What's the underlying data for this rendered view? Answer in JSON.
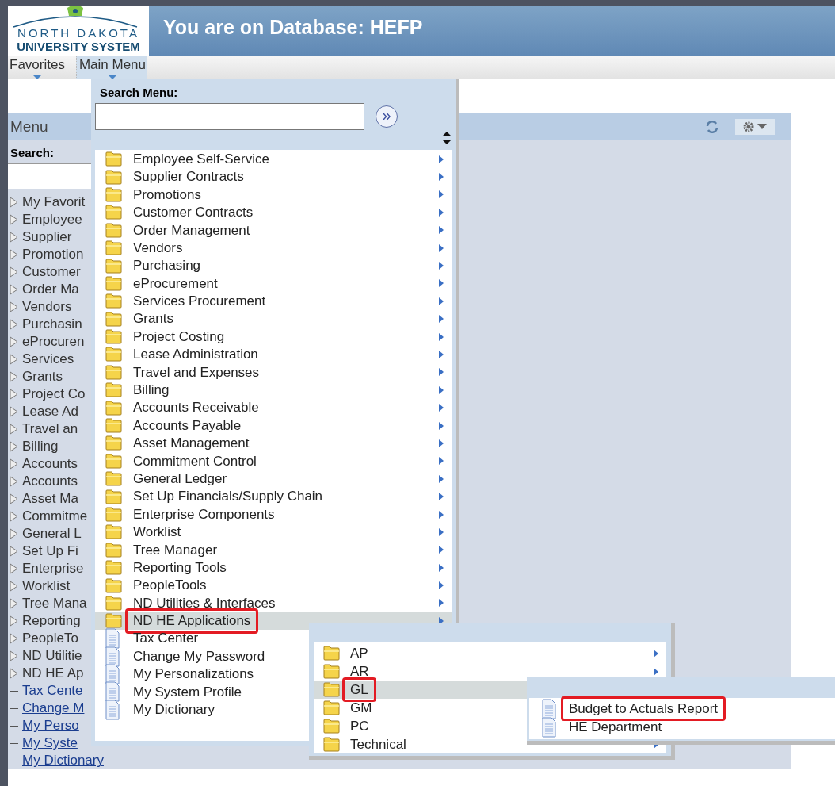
{
  "header": {
    "logo_line1": "NORTH DAKOTA",
    "logo_line2": "UNIVERSITY SYSTEM",
    "title": "You are on Database: HEFP"
  },
  "nav": [
    {
      "label": "Favorites",
      "selected": false
    },
    {
      "label": "Main Menu",
      "selected": true
    }
  ],
  "menu_pagelet": {
    "title": "Menu",
    "search_label": "Search:",
    "items": [
      {
        "label": "My Favorit",
        "kind": "folder"
      },
      {
        "label": "Employee",
        "kind": "folder"
      },
      {
        "label": "Supplier",
        "kind": "folder"
      },
      {
        "label": "Promotion",
        "kind": "folder"
      },
      {
        "label": "Customer",
        "kind": "folder"
      },
      {
        "label": "Order Ma",
        "kind": "folder"
      },
      {
        "label": "Vendors",
        "kind": "folder"
      },
      {
        "label": "Purchasin",
        "kind": "folder"
      },
      {
        "label": "eProcuren",
        "kind": "folder"
      },
      {
        "label": "Services",
        "kind": "folder"
      },
      {
        "label": "Grants",
        "kind": "folder"
      },
      {
        "label": "Project Co",
        "kind": "folder"
      },
      {
        "label": "Lease Ad",
        "kind": "folder"
      },
      {
        "label": "Travel an",
        "kind": "folder"
      },
      {
        "label": "Billing",
        "kind": "folder"
      },
      {
        "label": "Accounts",
        "kind": "folder"
      },
      {
        "label": "Accounts",
        "kind": "folder"
      },
      {
        "label": "Asset Ma",
        "kind": "folder"
      },
      {
        "label": "Commitme",
        "kind": "folder"
      },
      {
        "label": "General L",
        "kind": "folder"
      },
      {
        "label": "Set Up Fi",
        "kind": "folder"
      },
      {
        "label": "Enterprise",
        "kind": "folder"
      },
      {
        "label": "Worklist",
        "kind": "folder"
      },
      {
        "label": "Tree Mana",
        "kind": "folder"
      },
      {
        "label": "Reporting",
        "kind": "folder"
      },
      {
        "label": "PeopleTo",
        "kind": "folder"
      },
      {
        "label": "ND Utilitie",
        "kind": "folder"
      },
      {
        "label": "ND HE Ap",
        "kind": "folder"
      },
      {
        "label": "Tax Cente",
        "kind": "link"
      },
      {
        "label": "Change M",
        "kind": "link"
      },
      {
        "label": "My Perso",
        "kind": "link"
      },
      {
        "label": "My Syste",
        "kind": "link"
      },
      {
        "label": "My Dictionary",
        "kind": "link"
      }
    ]
  },
  "main_menu": {
    "search_label": "Search Menu:",
    "go_symbol": "»",
    "items": [
      {
        "label": "Employee Self-Service",
        "kind": "folder",
        "selected": false,
        "highlighted": false
      },
      {
        "label": "Supplier Contracts",
        "kind": "folder",
        "selected": false,
        "highlighted": false
      },
      {
        "label": "Promotions",
        "kind": "folder",
        "selected": false,
        "highlighted": false
      },
      {
        "label": "Customer Contracts",
        "kind": "folder",
        "selected": false,
        "highlighted": false
      },
      {
        "label": "Order Management",
        "kind": "folder",
        "selected": false,
        "highlighted": false
      },
      {
        "label": "Vendors",
        "kind": "folder",
        "selected": false,
        "highlighted": false
      },
      {
        "label": "Purchasing",
        "kind": "folder",
        "selected": false,
        "highlighted": false
      },
      {
        "label": "eProcurement",
        "kind": "folder",
        "selected": false,
        "highlighted": false
      },
      {
        "label": "Services Procurement",
        "kind": "folder",
        "selected": false,
        "highlighted": false
      },
      {
        "label": "Grants",
        "kind": "folder",
        "selected": false,
        "highlighted": false
      },
      {
        "label": "Project Costing",
        "kind": "folder",
        "selected": false,
        "highlighted": false
      },
      {
        "label": "Lease Administration",
        "kind": "folder",
        "selected": false,
        "highlighted": false
      },
      {
        "label": "Travel and Expenses",
        "kind": "folder",
        "selected": false,
        "highlighted": false
      },
      {
        "label": "Billing",
        "kind": "folder",
        "selected": false,
        "highlighted": false
      },
      {
        "label": "Accounts Receivable",
        "kind": "folder",
        "selected": false,
        "highlighted": false
      },
      {
        "label": "Accounts Payable",
        "kind": "folder",
        "selected": false,
        "highlighted": false
      },
      {
        "label": "Asset Management",
        "kind": "folder",
        "selected": false,
        "highlighted": false
      },
      {
        "label": "Commitment Control",
        "kind": "folder",
        "selected": false,
        "highlighted": false
      },
      {
        "label": "General Ledger",
        "kind": "folder",
        "selected": false,
        "highlighted": false
      },
      {
        "label": "Set Up Financials/Supply Chain",
        "kind": "folder",
        "selected": false,
        "highlighted": false
      },
      {
        "label": "Enterprise Components",
        "kind": "folder",
        "selected": false,
        "highlighted": false
      },
      {
        "label": "Worklist",
        "kind": "folder",
        "selected": false,
        "highlighted": false
      },
      {
        "label": "Tree Manager",
        "kind": "folder",
        "selected": false,
        "highlighted": false
      },
      {
        "label": "Reporting Tools",
        "kind": "folder",
        "selected": false,
        "highlighted": false
      },
      {
        "label": "PeopleTools",
        "kind": "folder",
        "selected": false,
        "highlighted": false
      },
      {
        "label": "ND Utilities & Interfaces",
        "kind": "folder",
        "selected": false,
        "highlighted": false
      },
      {
        "label": "ND HE Applications",
        "kind": "folder",
        "selected": true,
        "highlighted": true
      },
      {
        "label": "Tax Center",
        "kind": "page",
        "selected": false,
        "highlighted": false
      },
      {
        "label": "Change My Password",
        "kind": "page",
        "selected": false,
        "highlighted": false
      },
      {
        "label": "My Personalizations",
        "kind": "page",
        "selected": false,
        "highlighted": false
      },
      {
        "label": "My System Profile",
        "kind": "page",
        "selected": false,
        "highlighted": false
      },
      {
        "label": "My Dictionary",
        "kind": "page",
        "selected": false,
        "highlighted": false
      }
    ]
  },
  "submenu": {
    "items": [
      {
        "label": "AP",
        "kind": "folder",
        "selected": false,
        "highlighted": false,
        "arrow": true
      },
      {
        "label": "AR",
        "kind": "folder",
        "selected": false,
        "highlighted": false,
        "arrow": true
      },
      {
        "label": "GL",
        "kind": "folder",
        "selected": true,
        "highlighted": true,
        "arrow": false
      },
      {
        "label": "GM",
        "kind": "folder",
        "selected": false,
        "highlighted": false
      },
      {
        "label": "PC",
        "kind": "folder",
        "selected": false,
        "highlighted": false,
        "arrow": false
      },
      {
        "label": "Technical",
        "kind": "folder",
        "selected": false,
        "highlighted": false,
        "arrow": true
      }
    ]
  },
  "submenu2": {
    "items": [
      {
        "label": "Budget to Actuals Report",
        "kind": "page",
        "selected": false,
        "highlighted": true
      },
      {
        "label": "HE Department",
        "kind": "page",
        "selected": false,
        "highlighted": false
      }
    ]
  }
}
